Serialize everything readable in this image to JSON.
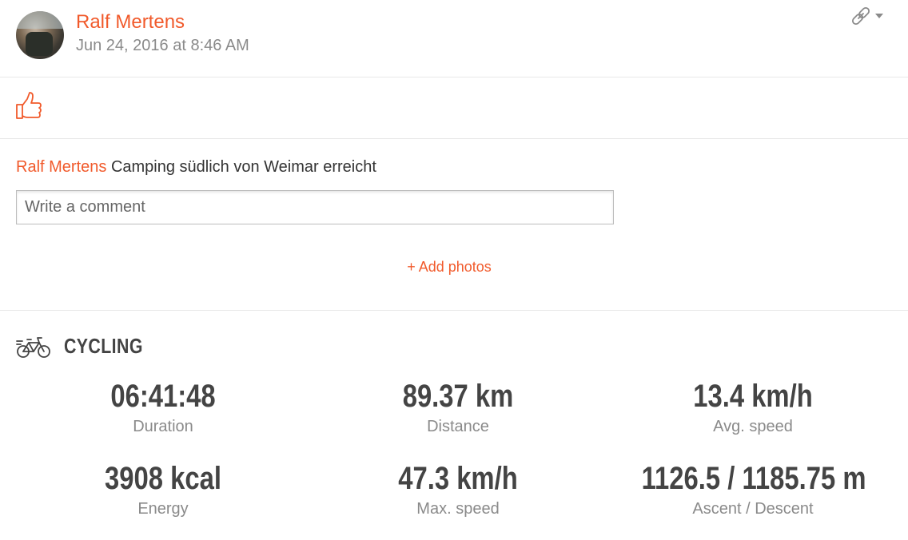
{
  "post": {
    "author": "Ralf Mertens",
    "date": "Jun 24, 2016 at 8:46 AM"
  },
  "caption": {
    "author": "Ralf Mertens",
    "text": "Camping südlich von Weimar erreicht"
  },
  "comment": {
    "placeholder": "Write a comment",
    "value": ""
  },
  "add_photos_label": "+ Add photos",
  "activity": {
    "type": "CYCLING",
    "icon": "bicycle-icon"
  },
  "stats": [
    {
      "value": "06:41:48",
      "label": "Duration"
    },
    {
      "value": "89.37 km",
      "label": "Distance"
    },
    {
      "value": "13.4 km/h",
      "label": "Avg. speed"
    },
    {
      "value": "3908 kcal",
      "label": "Energy"
    },
    {
      "value": "47.3 km/h",
      "label": "Max. speed"
    },
    {
      "value": "1126.5 / 1185.75 m",
      "label": "Ascent / Descent"
    }
  ],
  "colors": {
    "accent": "#f15a2b",
    "muted": "#8a8a8a",
    "stat_value": "#444444"
  },
  "icons": [
    "link-icon",
    "dropdown-caret-icon",
    "thumbs-up-icon",
    "bicycle-icon"
  ]
}
